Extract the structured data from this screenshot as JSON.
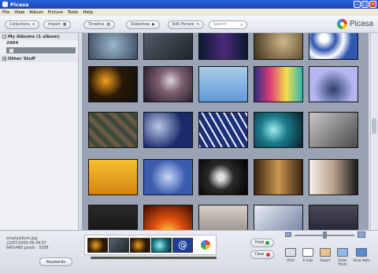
{
  "window": {
    "title": "Picasa"
  },
  "menu": [
    "File",
    "View",
    "Album",
    "Picture",
    "Tools",
    "Help"
  ],
  "toolbar": {
    "collections": "Collections",
    "import": "Import",
    "timeline": "Timeline",
    "slideshow": "Slideshow",
    "edit_picture": "Edit Picture",
    "search_placeholder": "Search",
    "logo": "Picasa"
  },
  "sidebar": {
    "albums_header": "My Albums (1 album)",
    "year": "2004",
    "other": "Other Stuff"
  },
  "selection": {
    "filename": "emptyalbum.jpg",
    "date": "22/07/2004 09:34:37",
    "dims": "640x480 pixels",
    "size": "31KB"
  },
  "bottom": {
    "keywords": "Keywords",
    "hold": "Hold",
    "clear": "Clear",
    "actions": [
      "Print",
      "E-mail",
      "Export",
      "Order Prints",
      "Send Hello"
    ]
  },
  "colors": {
    "titlebar": "#1a46b8",
    "grid_bg": "#9aa3b3",
    "hold_dot": "#3aa34a",
    "clear_dot": "#d8392c"
  }
}
